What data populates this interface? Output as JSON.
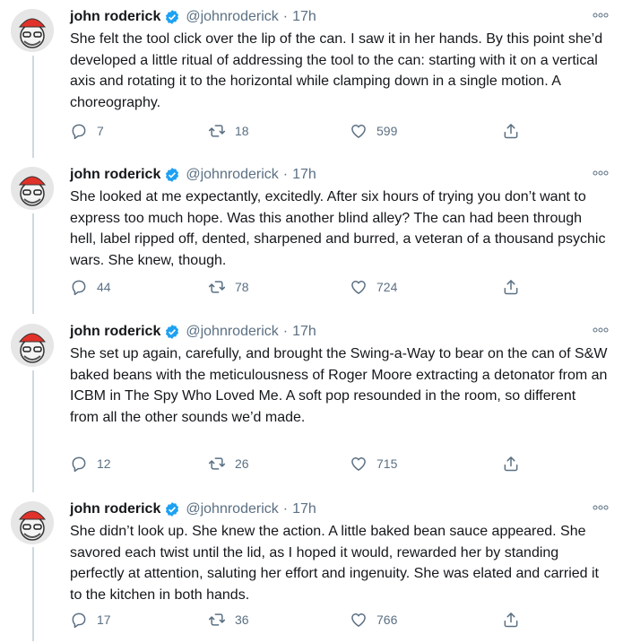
{
  "tweets": [
    {
      "name": "john roderick",
      "handle": "@johnroderick",
      "separator": "·",
      "time": "17h",
      "text": "She felt the tool click over the lip of the can. I saw it in her hands. By this point she’d developed a little ritual of addressing the tool to the can: starting with it on a vertical axis and rotating it to the horizontal while clamping down in a single motion. A choreography.",
      "replies": "7",
      "retweets": "18",
      "likes": "599"
    },
    {
      "name": "john roderick",
      "handle": "@johnroderick",
      "separator": "·",
      "time": "17h",
      "text": "She looked at me expectantly, excitedly. After six hours of trying you don’t want to express too much hope. Was this another blind alley? The can had been through hell, label ripped off, dented, sharpened and burred, a veteran of a thousand psychic wars. She knew, though.",
      "replies": "44",
      "retweets": "78",
      "likes": "724"
    },
    {
      "name": "john roderick",
      "handle": "@johnroderick",
      "separator": "·",
      "time": "17h",
      "text": "She set up again, carefully, and brought the Swing-a-Way to bear on the can of S&W baked beans with the meticulousness of Roger Moore extracting a detonator from an ICBM in The Spy Who Loved Me. A soft pop resounded in the room, so different from all the other sounds we’d made.",
      "replies": "12",
      "retweets": "26",
      "likes": "715"
    },
    {
      "name": "john roderick",
      "handle": "@johnroderick",
      "separator": "·",
      "time": "17h",
      "text": "She didn’t look up. She knew the action. A little baked bean sauce appeared. She savored each twist until the lid, as I hoped it would, rewarded her by standing perfectly at attention, saluting her effort and ingenuity. She was elated and carried it to the kitchen in both hands.",
      "replies": "17",
      "retweets": "36",
      "likes": "766"
    }
  ],
  "icons": {
    "reply": "reply-icon",
    "retweet": "retweet-icon",
    "like": "heart-icon",
    "share": "share-icon",
    "more": "more-icon",
    "verified": "verified-badge-icon"
  },
  "colors": {
    "text": "#14171a",
    "muted": "#5b7083",
    "verified": "#1da1f2",
    "thread_line": "#cfd9de",
    "avatar_cap": "#e0322a"
  }
}
